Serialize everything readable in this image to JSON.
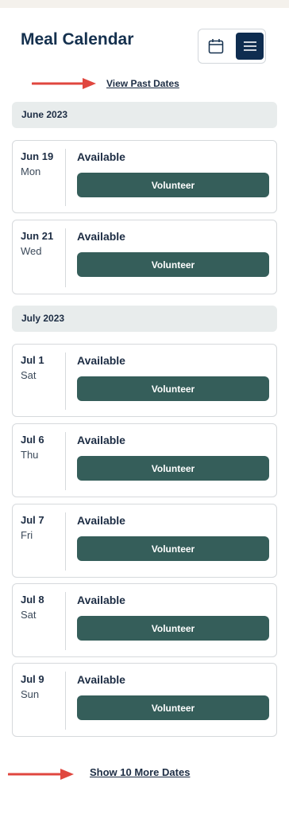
{
  "header": {
    "title": "Meal Calendar",
    "calendar_view_icon": "calendar-icon",
    "list_view_icon": "menu-lines-icon",
    "active_view": "list"
  },
  "links": {
    "view_past": "View Past Dates",
    "show_more": "Show 10 More Dates"
  },
  "colors": {
    "accent": "#0f2d50",
    "button": "#355e5a",
    "arrow": "#e0473f",
    "month_bg": "#e8ecec"
  },
  "months": [
    {
      "label": "June 2023",
      "entries": [
        {
          "date": "Jun 19",
          "day": "Mon",
          "status": "Available",
          "button": "Volunteer"
        },
        {
          "date": "Jun 21",
          "day": "Wed",
          "status": "Available",
          "button": "Volunteer"
        }
      ]
    },
    {
      "label": "July 2023",
      "entries": [
        {
          "date": "Jul 1",
          "day": "Sat",
          "status": "Available",
          "button": "Volunteer"
        },
        {
          "date": "Jul 6",
          "day": "Thu",
          "status": "Available",
          "button": "Volunteer"
        },
        {
          "date": "Jul 7",
          "day": "Fri",
          "status": "Available",
          "button": "Volunteer"
        },
        {
          "date": "Jul 8",
          "day": "Sat",
          "status": "Available",
          "button": "Volunteer"
        },
        {
          "date": "Jul 9",
          "day": "Sun",
          "status": "Available",
          "button": "Volunteer"
        }
      ]
    }
  ]
}
